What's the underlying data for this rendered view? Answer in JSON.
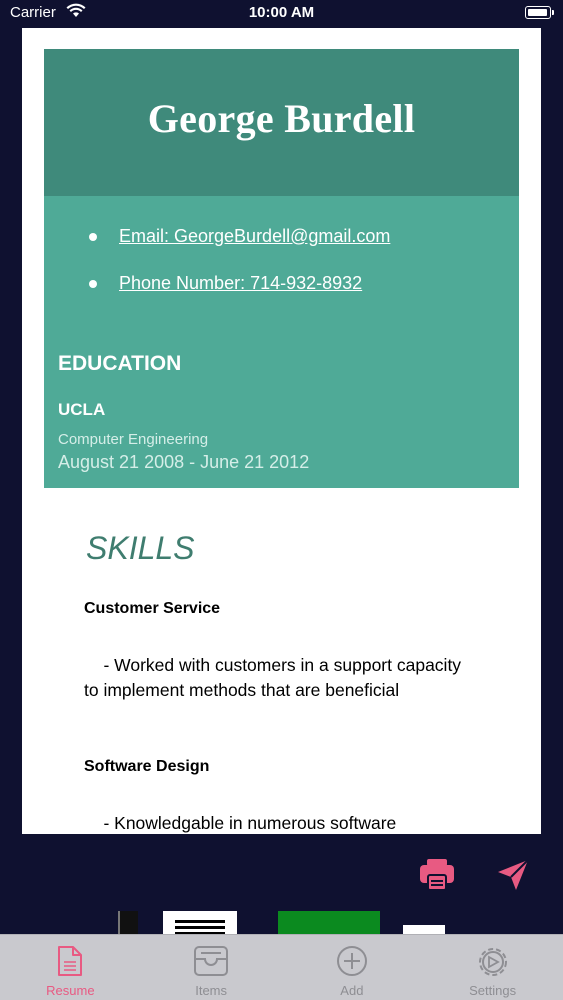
{
  "status_bar": {
    "carrier": "Carrier",
    "time": "10:00 AM"
  },
  "resume": {
    "name": "George Burdell",
    "contact": [
      {
        "label": "Email: GeorgeBurdell@gmail.com"
      },
      {
        "label": "Phone Number: 714-932-8932"
      }
    ],
    "education": {
      "title": "EDUCATION",
      "school": "UCLA",
      "major": "Computer Engineering",
      "dates": "August 21 2008 - June 21 2012"
    },
    "skills": {
      "title": "SKILLS",
      "items": [
        {
          "name": "Customer Service",
          "desc": "    - Worked with customers in a support capacity to implement methods that are beneficial"
        },
        {
          "name": "Software Design",
          "desc": "    - Knowledgable in numerous software"
        }
      ]
    }
  },
  "colors": {
    "header": "#3f8a7b",
    "contact_bg": "#4faa97",
    "accent_pink": "#e85a82",
    "background": "#0f1130"
  },
  "actions": {
    "print_icon": "printer-icon",
    "send_icon": "send-icon"
  },
  "tabs": [
    {
      "label": "Resume",
      "icon": "document-icon",
      "active": true
    },
    {
      "label": "Items",
      "icon": "tray-icon",
      "active": false
    },
    {
      "label": "Add",
      "icon": "plus-circle-icon",
      "active": false
    },
    {
      "label": "Settings",
      "icon": "gear-icon",
      "active": false
    }
  ]
}
